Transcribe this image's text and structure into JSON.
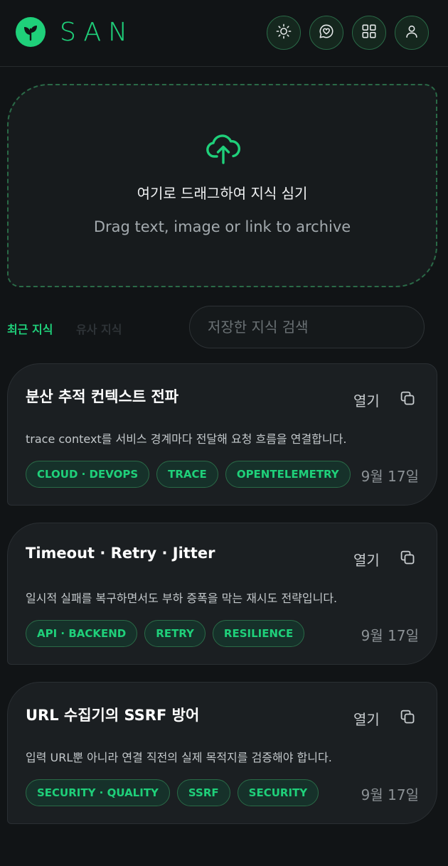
{
  "header": {
    "brand": "SAN",
    "icons": [
      "sun-icon",
      "heart-chat-icon",
      "grid-icon",
      "user-icon"
    ]
  },
  "dropzone": {
    "title": "여기로 드래그하여 지식 심기",
    "subtitle": "Drag text, image or link to archive",
    "icon": "cloud-upload-icon"
  },
  "tabs": [
    {
      "label": "최근 지식",
      "active": true
    },
    {
      "label": "유사 지식",
      "active": false
    }
  ],
  "search": {
    "placeholder": "저장한 지식 검색"
  },
  "cards": [
    {
      "title": "분산 추적 컨텍스트 전파",
      "open_label": "열기",
      "description": "trace context를 서비스 경계마다 전달해 요청 흐름을 연결합니다.",
      "tags": [
        "CLOUD · DEVOPS",
        "TRACE",
        "OPENTELEMETRY"
      ],
      "date": "9월 17일"
    },
    {
      "title": "Timeout · Retry · Jitter",
      "open_label": "열기",
      "description": "일시적 실패를 복구하면서도 부하 증폭을 막는 재시도 전략입니다.",
      "tags": [
        "API · BACKEND",
        "RETRY",
        "RESILIENCE"
      ],
      "date": "9월 17일"
    },
    {
      "title": "URL 수집기의 SSRF 방어",
      "open_label": "열기",
      "description": "입력 URL뿐 아니라 연결 직전의 실제 목적지를 검증해야 합니다.",
      "tags": [
        "SECURITY · QUALITY",
        "SSRF",
        "SECURITY"
      ],
      "date": "9월 17일"
    }
  ],
  "colors": {
    "accent": "#1fd07a",
    "background": "#111416",
    "card": "#1b1f22"
  }
}
